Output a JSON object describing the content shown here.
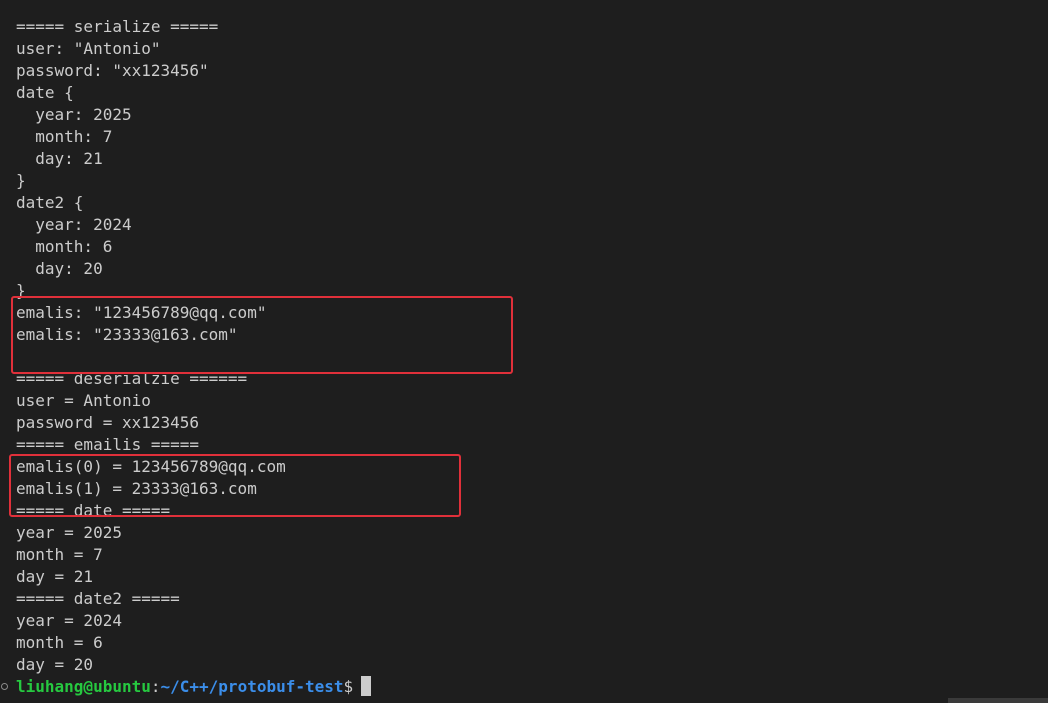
{
  "terminal": {
    "lines": [
      "===== serialize =====",
      "user: \"Antonio\"",
      "password: \"xx123456\"",
      "date {",
      "  year: 2025",
      "  month: 7",
      "  day: 21",
      "}",
      "date2 {",
      "  year: 2024",
      "  month: 6",
      "  day: 20",
      "}",
      "emalis: \"123456789@qq.com\"",
      "emalis: \"23333@163.com\"",
      "",
      "===== deserialzie ======",
      "user = Antonio",
      "password = xx123456",
      "===== emailis =====",
      "emalis(0) = 123456789@qq.com",
      "emalis(1) = 23333@163.com",
      "===== date =====",
      "year = 2025",
      "month = 7",
      "day = 21",
      "===== date2 =====",
      "year = 2024",
      "month = 6",
      "day = 20"
    ],
    "prompt": {
      "user_host": "liuhang@ubuntu",
      "separator": ":",
      "path": "~/C++/protobuf-test",
      "symbol": "$"
    }
  },
  "colors": {
    "background": "#1e1e1e",
    "text": "#cccccc",
    "prompt_user": "#26c940",
    "prompt_path": "#3b8eea",
    "highlight": "#e0303a"
  }
}
